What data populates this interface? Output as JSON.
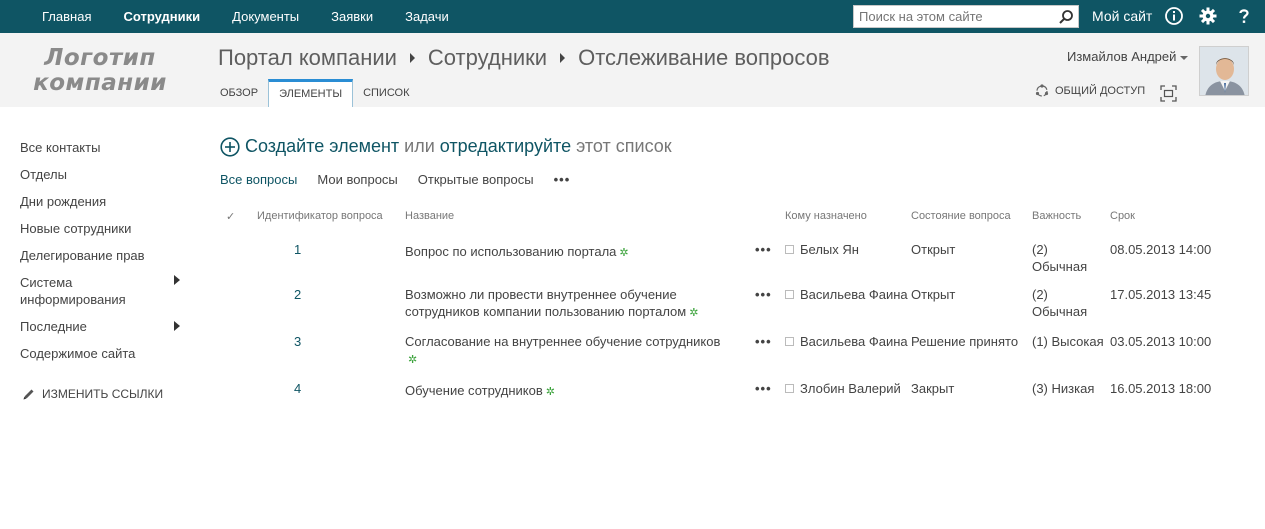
{
  "topnav": {
    "items": [
      {
        "label": "Главная",
        "active": false
      },
      {
        "label": "Сотрудники",
        "active": true
      },
      {
        "label": "Документы",
        "active": false
      },
      {
        "label": "Заявки",
        "active": false
      },
      {
        "label": "Задачи",
        "active": false
      }
    ],
    "search_placeholder": "Поиск на этом сайте",
    "mysite_label": "Мой сайт",
    "bg_color": "#0f5564"
  },
  "header": {
    "logo_line1": "Логотип",
    "logo_line2": "компании",
    "breadcrumb": [
      "Портал компании",
      "Сотрудники",
      "Отслеживание вопросов"
    ],
    "tabs": [
      {
        "label": "ОБЗОР",
        "active": false
      },
      {
        "label": "ЭЛЕМЕНТЫ",
        "active": true
      },
      {
        "label": "СПИСОК",
        "active": false
      }
    ],
    "user_name": "Измайлов Андрей",
    "share_label": "ОБЩИЙ ДОСТУП"
  },
  "leftnav": {
    "items": [
      {
        "label": "Все контакты"
      },
      {
        "label": "Отделы"
      },
      {
        "label": "Дни рождения"
      },
      {
        "label": "Новые сотрудники"
      },
      {
        "label": "Делегирование прав"
      },
      {
        "label": "Система информирования",
        "has_submenu": true
      },
      {
        "label": "Последние",
        "has_submenu": true
      },
      {
        "label": "Содержимое сайта"
      }
    ],
    "edit_links_label": "ИЗМЕНИТЬ ССЫЛКИ"
  },
  "main": {
    "new_item_link": "Создайте элемент",
    "or_text": "или",
    "edit_link": "отредактируйте",
    "list_text": "этот список",
    "views": [
      {
        "label": "Все вопросы",
        "active": true
      },
      {
        "label": "Мои вопросы",
        "active": false
      },
      {
        "label": "Открытые вопросы",
        "active": false
      }
    ],
    "views_more": "•••",
    "columns": {
      "check": "✓",
      "id": "Идентификатор вопроса",
      "title": "Название",
      "assigned": "Кому назначено",
      "status": "Состояние вопроса",
      "priority": "Важность",
      "due": "Срок"
    },
    "rows": [
      {
        "id": "1",
        "title": "Вопрос по использованию портала",
        "assigned": "Белых Ян",
        "status": "Открыт",
        "priority": "(2) Обычная",
        "due": "08.05.2013 14:00"
      },
      {
        "id": "2",
        "title": "Возможно ли провести внутреннее обучение сотрудников компании пользованию порталом",
        "assigned": "Васильева Фаина",
        "status": "Открыт",
        "priority": "(2) Обычная",
        "due": "17.05.2013 13:45"
      },
      {
        "id": "3",
        "title": "Согласование на внутреннее обучение сотрудников",
        "assigned": "Васильева Фаина",
        "status": "Решение принято",
        "priority": "(1) Высокая",
        "due": "03.05.2013 10:00"
      },
      {
        "id": "4",
        "title": "Обучение сотрудников",
        "assigned": "Злобин Валерий",
        "status": "Закрыт",
        "priority": "(3) Низкая",
        "due": "16.05.2013 18:00"
      }
    ],
    "new_marker": "✲",
    "row_menu": "•••"
  }
}
